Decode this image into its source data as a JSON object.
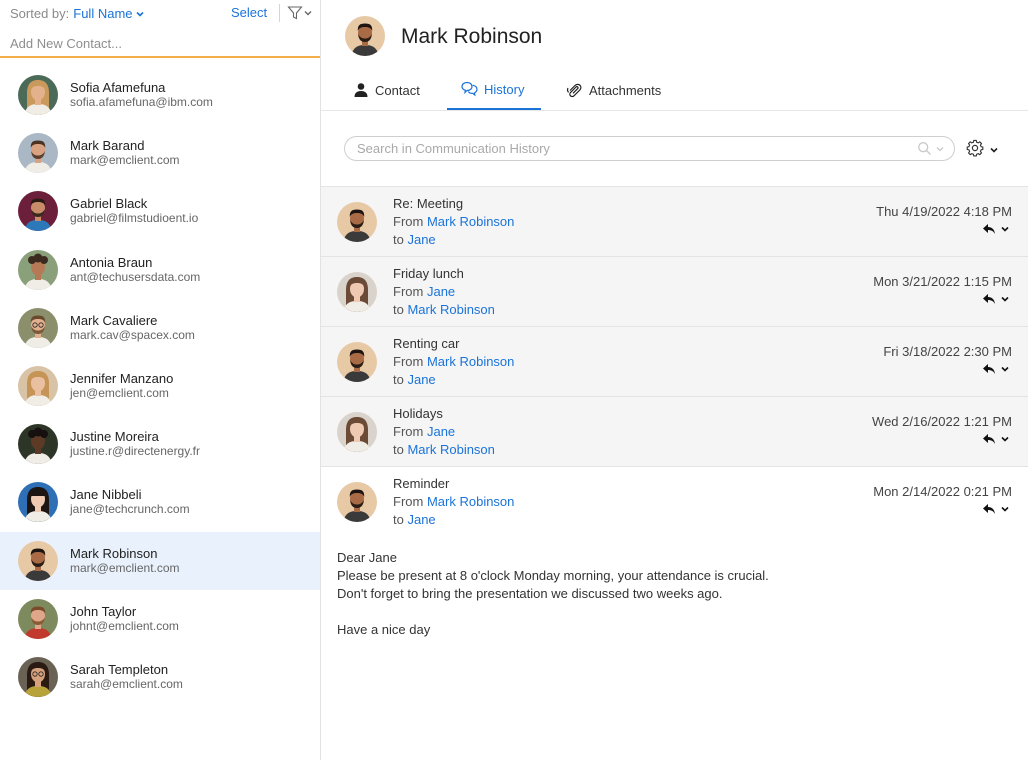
{
  "sort": {
    "label": "Sorted by:",
    "value": "Full Name",
    "select_label": "Select"
  },
  "add_contact": {
    "placeholder": "Add New Contact..."
  },
  "contacts": [
    {
      "name": "Sofia Afamefuna",
      "email": "sofia.afamefuna@ibm.com"
    },
    {
      "name": "Mark Barand",
      "email": "mark@emclient.com"
    },
    {
      "name": "Gabriel Black",
      "email": "gabriel@filmstudioent.io"
    },
    {
      "name": "Antonia Braun",
      "email": "ant@techusersdata.com"
    },
    {
      "name": "Mark Cavaliere",
      "email": "mark.cav@spacex.com"
    },
    {
      "name": "Jennifer Manzano",
      "email": "jen@emclient.com"
    },
    {
      "name": "Justine Moreira",
      "email": "justine.r@directenergy.fr"
    },
    {
      "name": "Jane Nibbeli",
      "email": "jane@techcrunch.com"
    },
    {
      "name": "Mark Robinson",
      "email": "mark@emclient.com"
    },
    {
      "name": "John Taylor",
      "email": "johnt@emclient.com"
    },
    {
      "name": "Sarah Templeton",
      "email": "sarah@emclient.com"
    }
  ],
  "selected_contact": "Mark Robinson",
  "header": {
    "name": "Mark Robinson"
  },
  "tabs": [
    {
      "label": "Contact",
      "icon": "person-icon"
    },
    {
      "label": "History",
      "icon": "chat-bubbles-icon",
      "active": true
    },
    {
      "label": "Attachments",
      "icon": "paperclip-icon"
    }
  ],
  "history_search": {
    "placeholder": "Search in Communication History"
  },
  "messages": [
    {
      "subject": "Re: Meeting",
      "from_label": "From",
      "from": "Mark Robinson",
      "to_label": "to",
      "to": "Jane",
      "date": "Thu 4/19/2022 4:18 PM"
    },
    {
      "subject": "Friday lunch",
      "from_label": "From",
      "from": "Jane",
      "to_label": "to",
      "to": "Mark Robinson",
      "date": "Mon 3/21/2022 1:15 PM"
    },
    {
      "subject": "Renting car",
      "from_label": "From",
      "from": "Mark Robinson",
      "to_label": "to",
      "to": "Jane",
      "date": "Fri 3/18/2022 2:30 PM"
    },
    {
      "subject": "Holidays",
      "from_label": "From",
      "from": "Jane",
      "to_label": "to",
      "to": "Mark Robinson",
      "date": "Wed 2/16/2022 1:21 PM"
    },
    {
      "subject": "Reminder",
      "from_label": "From",
      "from": "Mark Robinson",
      "to_label": "to",
      "to": "Jane",
      "date": "Mon 2/14/2022 0:21 PM",
      "body": [
        "Dear Jane",
        "Please be present at 8 o'clock Monday morning, your attendance is crucial.",
        "Don't forget to bring the presentation we discussed two weeks ago.",
        "",
        "Have a nice day"
      ]
    }
  ],
  "colors": {
    "accent": "#1a73d9",
    "input_underline": "#f3b04a",
    "selected_row": "#e9f2fc",
    "message_bg": "#f5f5f5"
  }
}
